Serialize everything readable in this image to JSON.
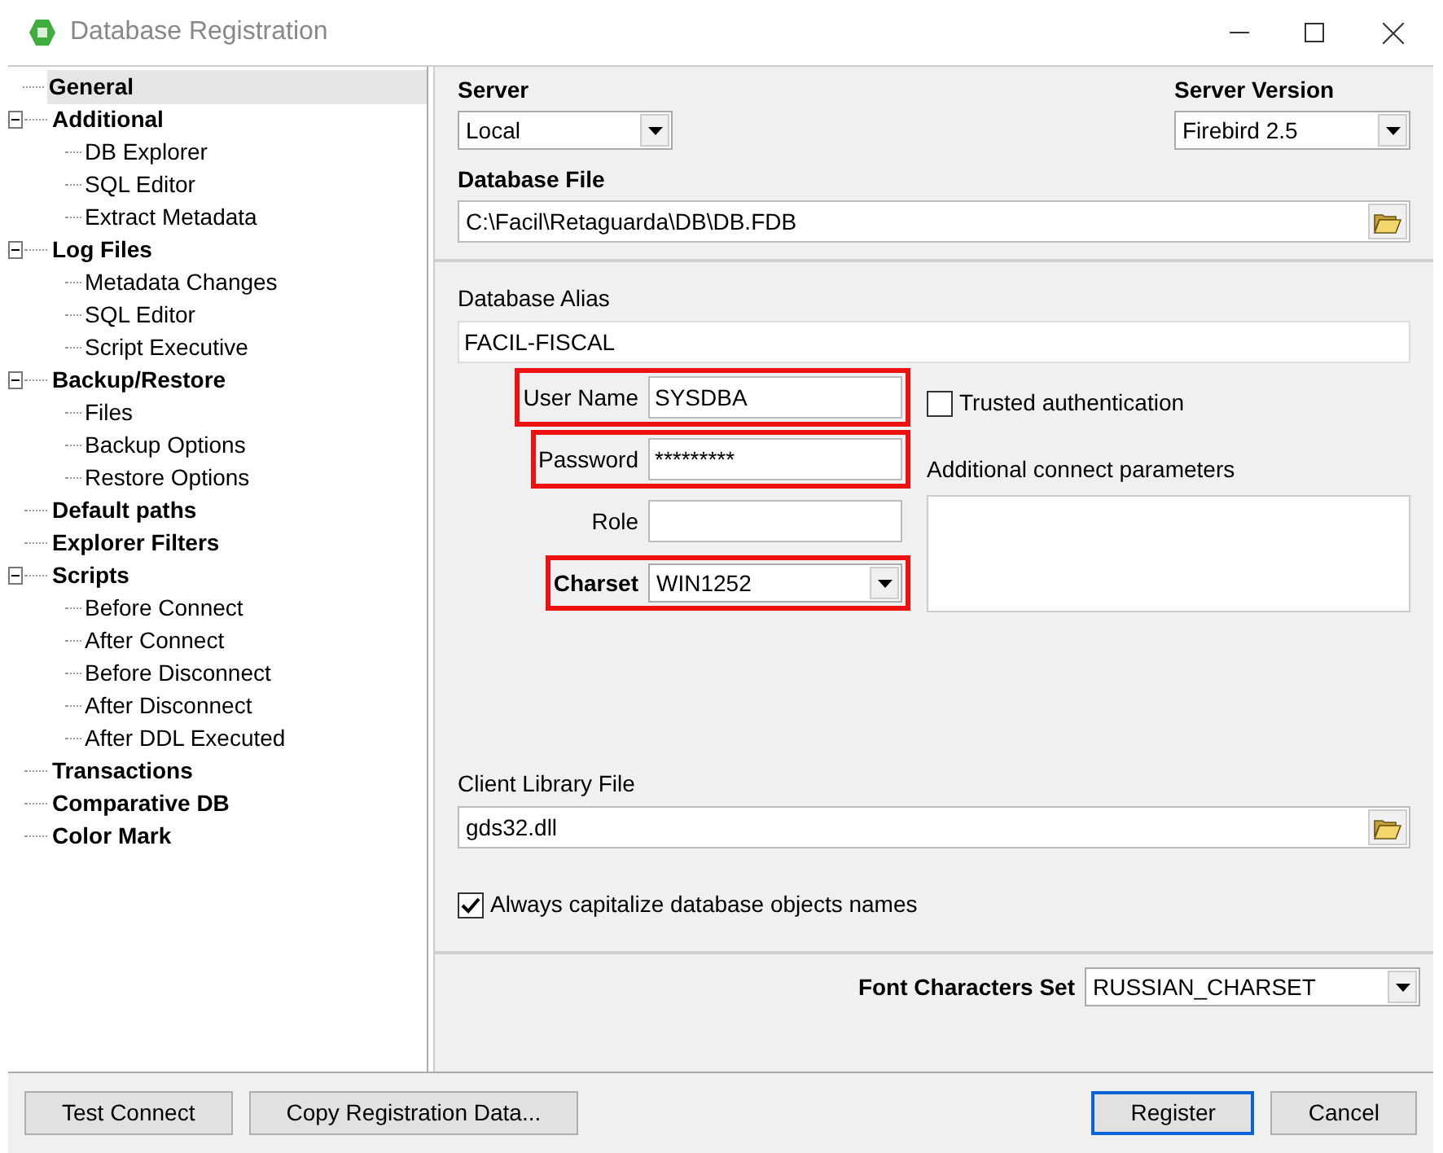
{
  "window": {
    "title": "Database Registration"
  },
  "tree": [
    {
      "label": "General",
      "selected": true
    },
    {
      "label": "Additional",
      "selected": false,
      "expanded": true,
      "children": [
        {
          "label": "DB Explorer",
          "selected": false
        },
        {
          "label": "SQL Editor",
          "selected": false
        },
        {
          "label": "Extract Metadata",
          "selected": false
        }
      ]
    },
    {
      "label": "Log Files",
      "selected": false,
      "expanded": true,
      "children": [
        {
          "label": "Metadata Changes",
          "selected": false
        },
        {
          "label": "SQL Editor",
          "selected": false
        },
        {
          "label": "Script Executive",
          "selected": false
        }
      ]
    },
    {
      "label": "Backup/Restore",
      "selected": false,
      "expanded": true,
      "children": [
        {
          "label": "Files",
          "selected": false
        },
        {
          "label": "Backup Options",
          "selected": false
        },
        {
          "label": "Restore Options",
          "selected": false
        }
      ]
    },
    {
      "label": "Default paths",
      "selected": false
    },
    {
      "label": "Explorer Filters",
      "selected": false
    },
    {
      "label": "Scripts",
      "selected": false,
      "expanded": true,
      "children": [
        {
          "label": "Before Connect",
          "selected": false
        },
        {
          "label": "After Connect",
          "selected": false
        },
        {
          "label": "Before Disconnect",
          "selected": false
        },
        {
          "label": "After Disconnect",
          "selected": false
        },
        {
          "label": "After DDL Executed",
          "selected": false
        }
      ]
    },
    {
      "label": "Transactions",
      "selected": false
    },
    {
      "label": "Comparative DB",
      "selected": false
    },
    {
      "label": "Color Mark",
      "selected": false
    }
  ],
  "server": {
    "label": "Server",
    "value": "Local"
  },
  "server_version": {
    "label": "Server Version",
    "value": "Firebird 2.5"
  },
  "database_file": {
    "label": "Database File",
    "value": "C:\\Facil\\Retaguarda\\DB\\DB.FDB"
  },
  "database_alias": {
    "label": "Database Alias",
    "value": "FACIL-FISCAL"
  },
  "credentials": [
    {
      "kind": "text",
      "label": "User Name",
      "value": "SYSDBA",
      "highlighted": true,
      "bold": false
    },
    {
      "kind": "text",
      "label": "Password",
      "value": "*********",
      "highlighted": true,
      "bold": false
    },
    {
      "kind": "text",
      "label": "Role",
      "highlighted": false,
      "bold": false
    },
    {
      "kind": "combo",
      "label": "Charset",
      "value": "WIN1252",
      "highlighted": true,
      "bold": true
    }
  ],
  "trusted_authentication": {
    "label": "Trusted authentication",
    "checked": false
  },
  "additional_params": {
    "label": "Additional connect parameters"
  },
  "client_library": {
    "label": "Client Library File",
    "value": "gds32.dll"
  },
  "capitalize": {
    "label": "Always capitalize database objects names",
    "checked": true
  },
  "font_charset": {
    "label": "Font Characters Set",
    "value": "RUSSIAN_CHARSET"
  },
  "left_buttons": [
    {
      "label": "Test Connect",
      "default": false
    },
    {
      "label": "Copy Registration Data...",
      "default": false
    }
  ],
  "right_buttons": [
    {
      "label": "Register",
      "default": true
    },
    {
      "label": "Cancel",
      "default": false
    }
  ]
}
